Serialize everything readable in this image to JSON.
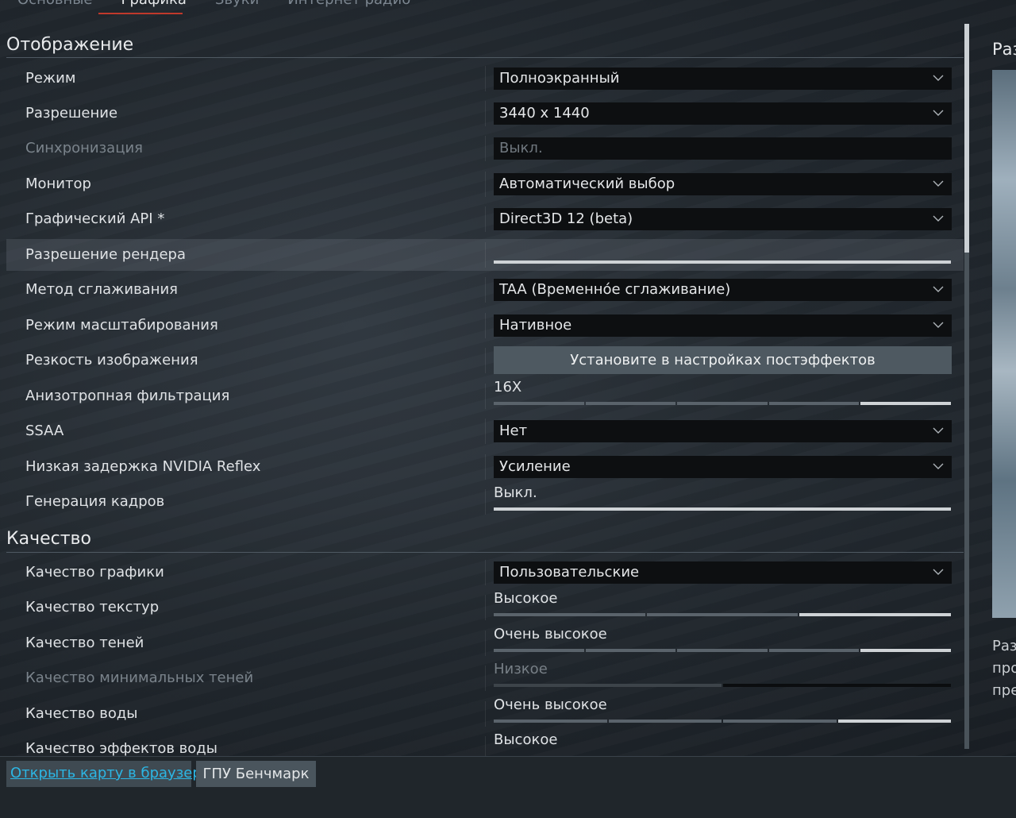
{
  "tabs": [
    {
      "label": "Основные"
    },
    {
      "label": "Графика"
    },
    {
      "label": "Звуки"
    },
    {
      "label": "Интернет радио"
    }
  ],
  "sections": {
    "display_title": "Отображение",
    "quality_title": "Качество"
  },
  "display": {
    "mode": {
      "label": "Режим",
      "value": "Полноэкранный"
    },
    "resolution": {
      "label": "Разрешение",
      "value": "3440 x 1440"
    },
    "vsync": {
      "label": "Синхронизация",
      "value": "Выкл."
    },
    "monitor": {
      "label": "Монитор",
      "value": "Автоматический выбор"
    },
    "api": {
      "label": "Графический API *",
      "value": "Direct3D 12 (beta)"
    },
    "render_res": {
      "label": "Разрешение рендера",
      "level": 1.0
    },
    "aa": {
      "label": "Метод сглаживания",
      "value": "TAA (Временно́е сглаживание)"
    },
    "scaling": {
      "label": "Режим масштабирования",
      "value": "Нативное"
    },
    "sharpness": {
      "label": "Резкость изображения",
      "button": "Установите в настройках постэффектов"
    },
    "aniso": {
      "label": "Анизотропная фильтрация",
      "value": "16X",
      "steps": 5,
      "selected": 5
    },
    "ssaa": {
      "label": "SSAA",
      "value": "Нет"
    },
    "reflex": {
      "label": "Низкая задержка NVIDIA Reflex",
      "value": "Усиление"
    },
    "framegen": {
      "label": "Генерация кадров",
      "value": "Выкл.",
      "level": 1.0
    }
  },
  "quality": {
    "preset": {
      "label": "Качество графики",
      "value": "Пользовательские"
    },
    "textures": {
      "label": "Качество текстур",
      "value": "Высокое",
      "steps": 3,
      "selected": 3
    },
    "shadows": {
      "label": "Качество теней",
      "value": "Очень высокое",
      "steps": 5,
      "selected": 5
    },
    "min_shadows": {
      "label": "Качество минимальных теней",
      "value": "Низкое",
      "steps": 2,
      "selected": 1
    },
    "water": {
      "label": "Качество воды",
      "value": "Очень высокое",
      "steps": 4,
      "selected": 4
    },
    "water_fx": {
      "label": "Качество эффектов воды",
      "value": "Высокое"
    }
  },
  "right_panel": {
    "title": "Раз",
    "desc": [
      "Раз",
      "про",
      "пре"
    ]
  },
  "bottom": {
    "open_map": "Открыть карту в браузере",
    "gpu_bench": "ГПУ Бенчмарк"
  },
  "colors": {
    "accent_tab": "#c0392b",
    "link": "#2cb6e4"
  }
}
